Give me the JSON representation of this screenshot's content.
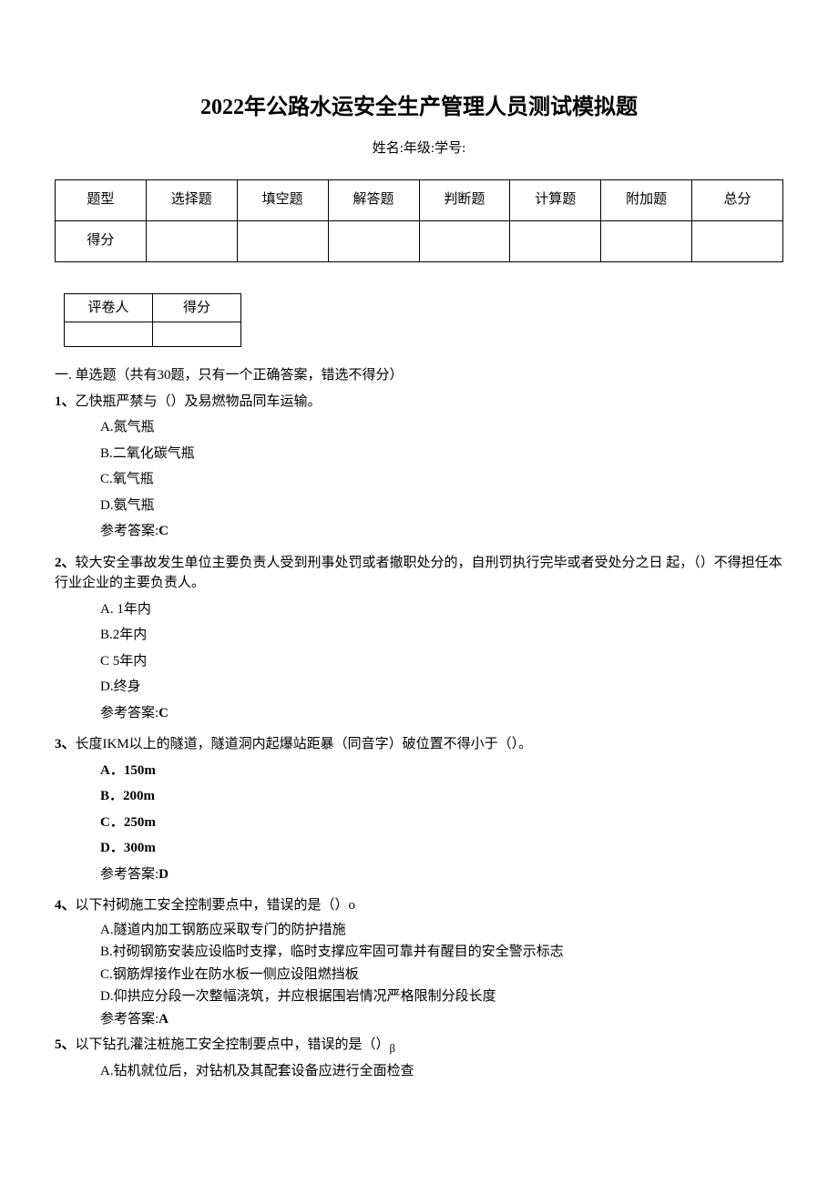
{
  "title": "2022年公路水运安全生产管理人员测试模拟题",
  "subline": "姓名:年级:学号:",
  "table_main": {
    "row1": [
      "题型",
      "选择题",
      "填空题",
      "解答题",
      "判断题",
      "计算题",
      "附加题",
      "总分"
    ],
    "row2_label": "得分"
  },
  "grader": {
    "c1": "评卷人",
    "c2": "得分"
  },
  "section1": "一. 单选题（共有30题，只有一个正确答案，错选不得分）",
  "answer_prefix": "参考答案:",
  "q1": {
    "num": "1、",
    "stem": "乙快瓶严禁与（）及易燃物品同车运输。",
    "opts": [
      "A.氮气瓶",
      "B.二氧化碳气瓶",
      "C.氧气瓶",
      "D.氨气瓶"
    ],
    "ans": "C"
  },
  "q2": {
    "num": "2、",
    "stem": "较大安全事故发生单位主要负责人受到刑事处罚或者撤职处分的，自刑罚执行完毕或者受处分之日 起，（）不得担任本行业企业的主要负责人。",
    "opts": [
      "A. 1年内",
      "B.2年内",
      "C 5年内",
      "D.终身"
    ],
    "ans": "C"
  },
  "q3": {
    "num": "3、",
    "stem": "长度IKM以上的隧道，隧道洞内起爆站距暴（同音字）破位置不得小于（）。",
    "opts": [
      "A．150m",
      "B．200m",
      "C．250m",
      "D．300m"
    ],
    "ans": "D"
  },
  "q4": {
    "num": "4、",
    "stem": "以下衬砌施工安全控制要点中，错误的是（）o",
    "opts": [
      "A.隧道内加工钢筋应采取专门的防护措施",
      "B.衬砌钢筋安装应设临时支撑，临时支撑应牢固可靠并有醒目的安全警示标志",
      "C.钢筋焊接作业在防水板一侧应设阻燃挡板",
      "D.仰拱应分段一次整幅浇筑，并应根据围岩情况严格限制分段长度"
    ],
    "ans": "A"
  },
  "q5": {
    "num": "5、",
    "stem_pre": "以下钻孔灌注桩施工安全控制要点中，错误的是（）",
    "stem_sub": "β",
    "opts": [
      "A.钻机就位后，对钻机及其配套设备应进行全面检查"
    ]
  }
}
